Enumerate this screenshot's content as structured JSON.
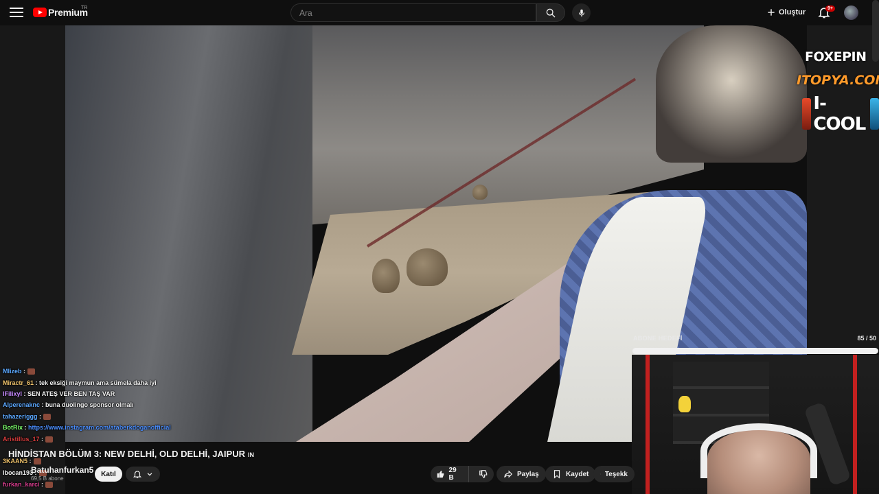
{
  "header": {
    "logo_text": "Premium",
    "logo_country": "TR",
    "search_placeholder": "Ara",
    "create_label": "Oluştur",
    "notification_badge": "9+"
  },
  "sponsors": {
    "foxepin": "FOXEPIN",
    "itopya": "ITOPYA.COM",
    "icool": "I-COOL"
  },
  "subscriber_goal": {
    "label": "ABONE HEDEFİ",
    "count": "85 / 50",
    "fraction": 1.0
  },
  "chat": [
    {
      "user": "Mlizeb",
      "color": "#5ba8ff",
      "text": ""
    },
    {
      "user": "Miractr_61",
      "color": "#f0c36b",
      "text": "tek eksiği maymun ama sümela daha iyi"
    },
    {
      "user": "IFilixyl",
      "color": "#c78bff",
      "text": "SEN ATEŞ VER BEN TAŞ VAR"
    },
    {
      "user": "Alperenaknc",
      "color": "#5ba8ff",
      "text": "buna duolingo sponsor olmalı"
    },
    {
      "user": "tahazeriggg",
      "color": "#5ba8ff",
      "text": ""
    },
    {
      "user": "BotRix",
      "color": "#7cff6b",
      "text": "https://www.instagram.com/ataberkdoganofficial"
    },
    {
      "user": "Aristillus_17",
      "color": "#d63c3c",
      "text": ""
    },
    {
      "user": "3KAAN5",
      "color": "#f0c36b",
      "text": ""
    },
    {
      "user": "Ibocan193",
      "color": "#f1f1f1",
      "text": ""
    },
    {
      "user": "furkan_karci",
      "color": "#d63c8c",
      "text": ""
    }
  ],
  "video": {
    "title": "HİNDİSTAN BÖLÜM 3: NEW DELHİ, OLD DELHİ, JAIPUR",
    "title_tag": "IN",
    "channel": "Batuhanfurkan5",
    "subscribers": "69,5 B abone",
    "join_label": "Katıl",
    "likes": "29 B",
    "share_label": "Paylaş",
    "save_label": "Kaydet",
    "thanks_label": "Teşekk"
  }
}
